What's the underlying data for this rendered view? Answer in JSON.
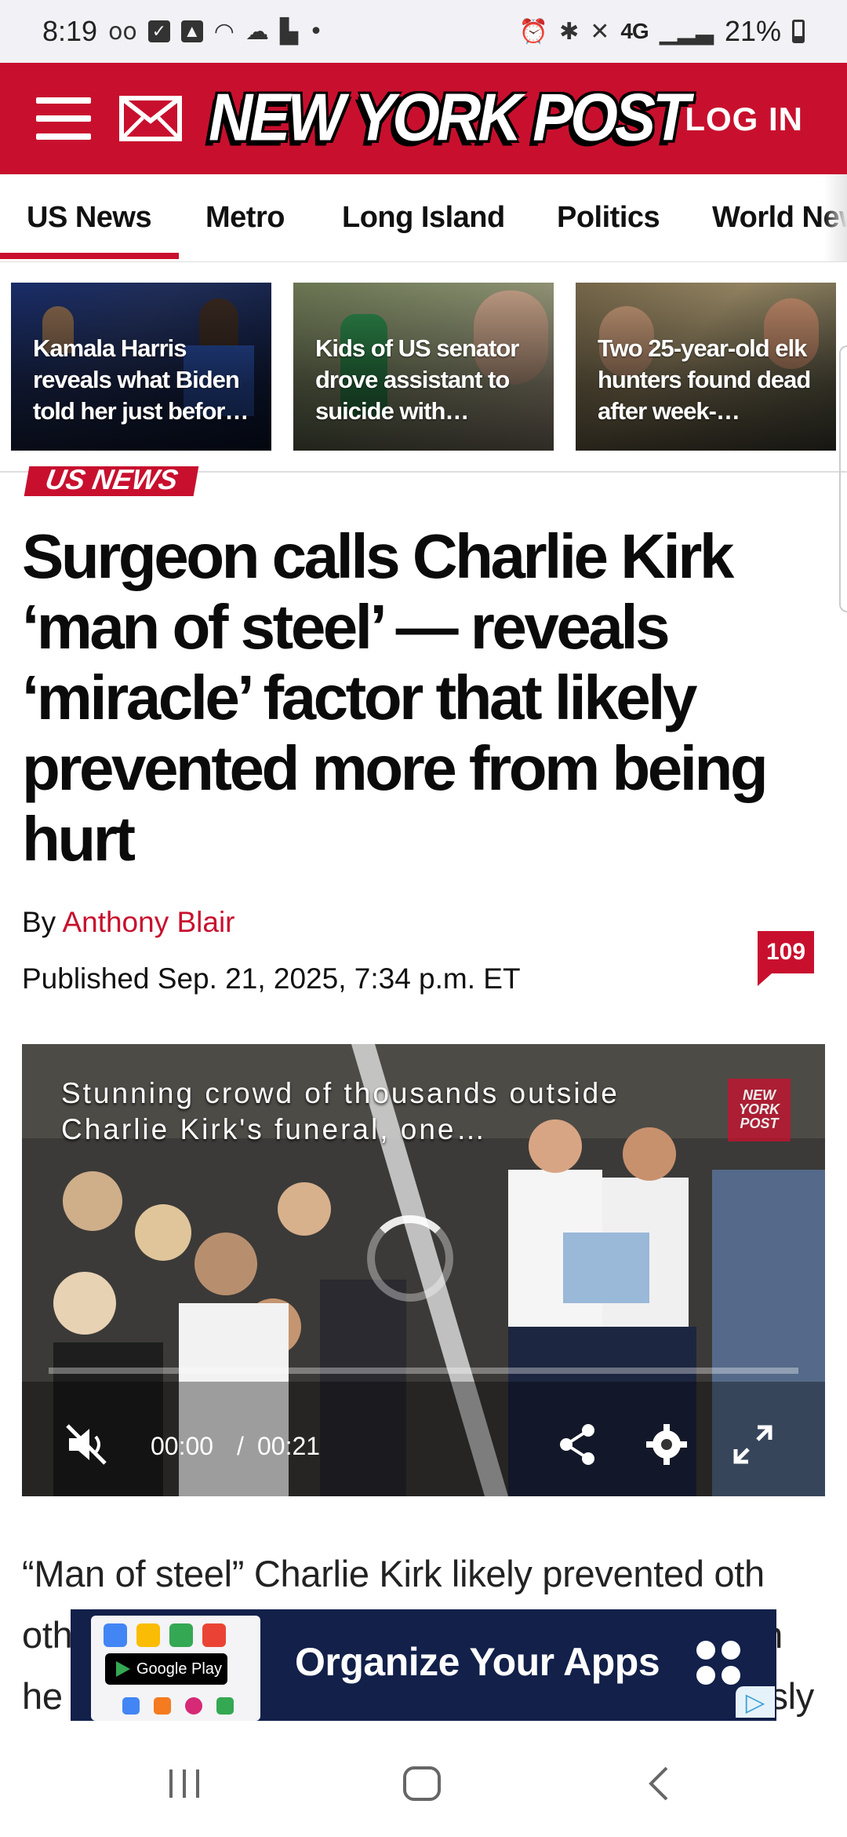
{
  "status_bar": {
    "time": "8:19",
    "network": "4G",
    "battery": "21%",
    "icons": [
      "voicemail-icon",
      "checkbox-icon",
      "gallery-icon",
      "wifi-icon",
      "cloud-icon",
      "chart-icon",
      "dot-icon",
      "alarm-icon",
      "bluetooth-icon",
      "mute-icon",
      "signal-icon",
      "battery-icon"
    ]
  },
  "header": {
    "logo": "NEW YORK POST",
    "login": "LOG IN",
    "brand_color": "#c8102e"
  },
  "nav": {
    "tabs": [
      "US News",
      "Metro",
      "Long Island",
      "Politics",
      "World News"
    ],
    "active": "US News"
  },
  "stories": [
    {
      "caption": "Kamala Harris reveals what Biden told her just befor…"
    },
    {
      "caption": "Kids of US senator drove assistant to suicide with…"
    },
    {
      "caption": "Two 25-year-old elk hunters found dead after week-…"
    }
  ],
  "article": {
    "section": "US NEWS",
    "headline": "Surgeon calls Charlie Kirk ‘man of steel’ — reveals ‘miracle’ factor that likely prevented more from being hurt",
    "by_prefix": "By",
    "author": "Anthony Blair",
    "published": "Published Sep. 21, 2025, 7:34 p.m. ET",
    "comment_count": "109",
    "body_start": "“Man of steel” Charlie Kirk likely prevented oth",
    "body_line2_start": "oth",
    "body_line2_end": "n",
    "body_line3_start": "he",
    "body_line3_end": "sly"
  },
  "video": {
    "title": "Stunning crowd of thousands outside Charlie Kirk's funeral, one…",
    "current_time": "00:00",
    "separator": "/",
    "duration": "00:21",
    "progress": 0,
    "logo": "NEW YORK POST"
  },
  "ad": {
    "store_label": "Google Play",
    "text": "Organize Your Apps"
  }
}
